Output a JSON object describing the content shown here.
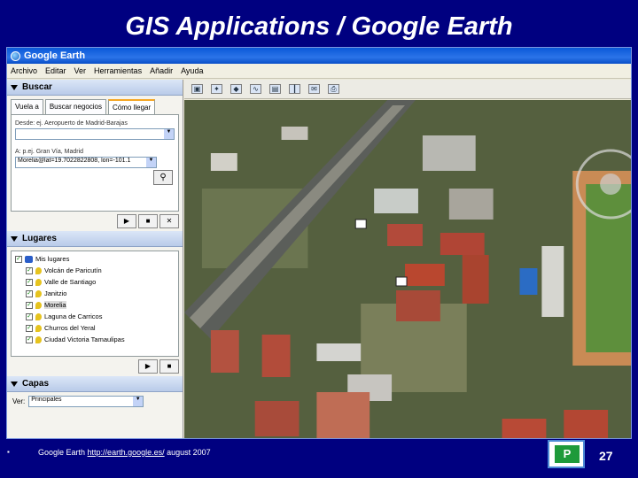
{
  "slide": {
    "title": "GIS Applications / Google Earth",
    "page_number": "27"
  },
  "window": {
    "title": "Google Earth"
  },
  "menu": [
    "Archivo",
    "Editar",
    "Ver",
    "Herramientas",
    "Añadir",
    "Ayuda"
  ],
  "search_panel": {
    "header": "Buscar",
    "tabs": [
      "Vuela a",
      "Buscar negocios",
      "Cómo llegar"
    ],
    "from_label": "Desde: ej. Aeropuerto de Madrid-Barajas",
    "from_value": "",
    "to_label": "A: p.ej. Gran Vía, Madrid",
    "to_value": "Morelia@lat=19.7022822808, lon=-101.1"
  },
  "places_panel": {
    "header": "Lugares",
    "root": "Mis lugares",
    "items": [
      {
        "label": "Volcán de Paricutín",
        "selected": false
      },
      {
        "label": "Valle de Santiago",
        "selected": false
      },
      {
        "label": "Janitzio",
        "selected": false
      },
      {
        "label": "Morelia",
        "selected": true
      },
      {
        "label": "Laguna de Carricos",
        "selected": false
      },
      {
        "label": "Churros del Yeral",
        "selected": false
      },
      {
        "label": "Ciudad Victoria Tamaulipas",
        "selected": false
      }
    ]
  },
  "layers_panel": {
    "header": "Capas",
    "view_label": "Ver:",
    "view_value": "Principales"
  },
  "footer": {
    "bullet": "▪",
    "prefix": "Google Earth ",
    "url": "http://earth.google.es/",
    "suffix": " august 2007"
  }
}
